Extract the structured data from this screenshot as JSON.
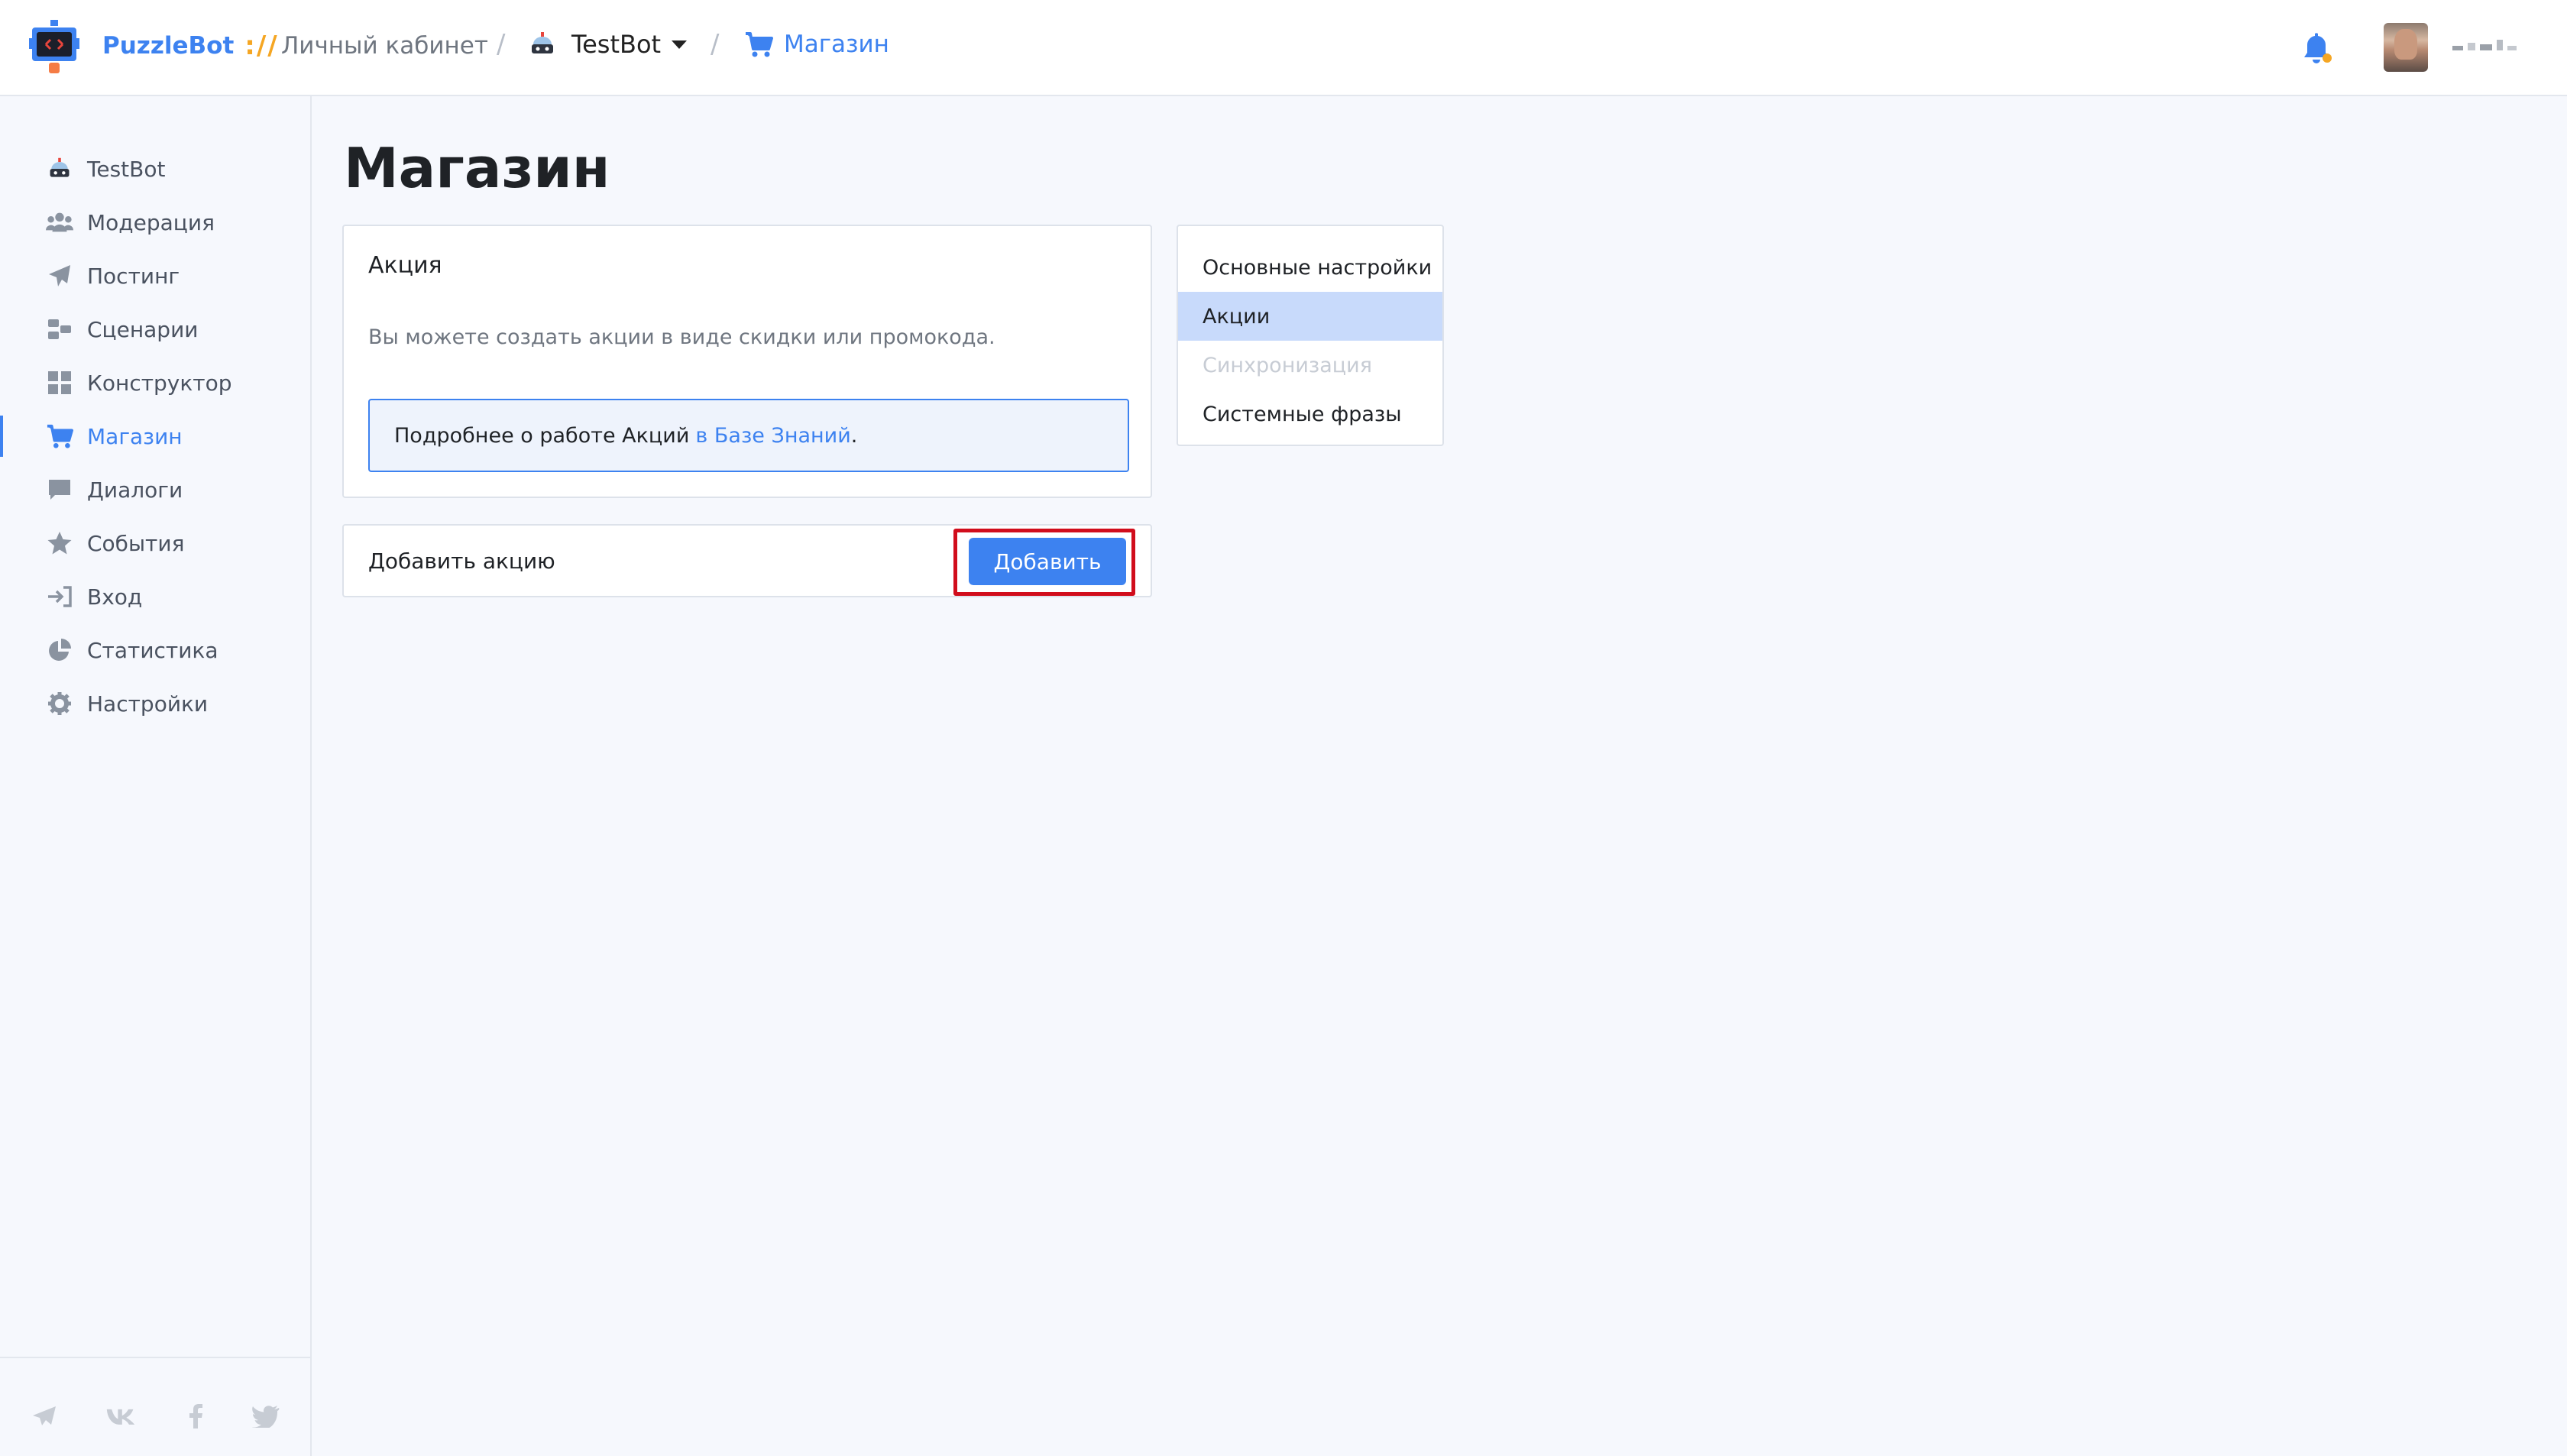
{
  "header": {
    "brand": "PuzzleBot",
    "brand_separator": "://",
    "cabinet": "Личный кабинет",
    "bot_name": "TestBot",
    "section": "Магазин"
  },
  "sidebar": {
    "items": [
      {
        "label": "TestBot",
        "icon": "bot-icon"
      },
      {
        "label": "Модерация",
        "icon": "users-icon"
      },
      {
        "label": "Постинг",
        "icon": "paper-plane-icon"
      },
      {
        "label": "Сценарии",
        "icon": "scenario-icon"
      },
      {
        "label": "Конструктор",
        "icon": "grid-icon"
      },
      {
        "label": "Магазин",
        "icon": "cart-icon",
        "active": true
      },
      {
        "label": "Диалоги",
        "icon": "chat-icon"
      },
      {
        "label": "События",
        "icon": "star-icon"
      },
      {
        "label": "Вход",
        "icon": "sign-in-icon"
      },
      {
        "label": "Статистика",
        "icon": "pie-chart-icon"
      },
      {
        "label": "Настройки",
        "icon": "gear-icon"
      }
    ],
    "social": [
      "telegram-icon",
      "vk-icon",
      "facebook-icon",
      "twitter-icon"
    ]
  },
  "main": {
    "title": "Магазин",
    "promo_card": {
      "title": "Акция",
      "description": "Вы можете создать акции в виде скидки или промокода.",
      "info_text": "Подробнее о работе Акций",
      "info_link": "в Базе Знаний",
      "info_suffix": "."
    },
    "add_card": {
      "label": "Добавить акцию",
      "button": "Добавить"
    },
    "settings_menu": [
      {
        "label": "Основные настройки",
        "state": "normal"
      },
      {
        "label": "Акции",
        "state": "active"
      },
      {
        "label": "Синхронизация",
        "state": "disabled"
      },
      {
        "label": "Системные фразы",
        "state": "normal"
      }
    ]
  },
  "colors": {
    "accent": "#3d82f0",
    "highlight": "#d10d1c",
    "brand_separator": "#f5a623",
    "active_menu_bg": "#c8dafb"
  }
}
